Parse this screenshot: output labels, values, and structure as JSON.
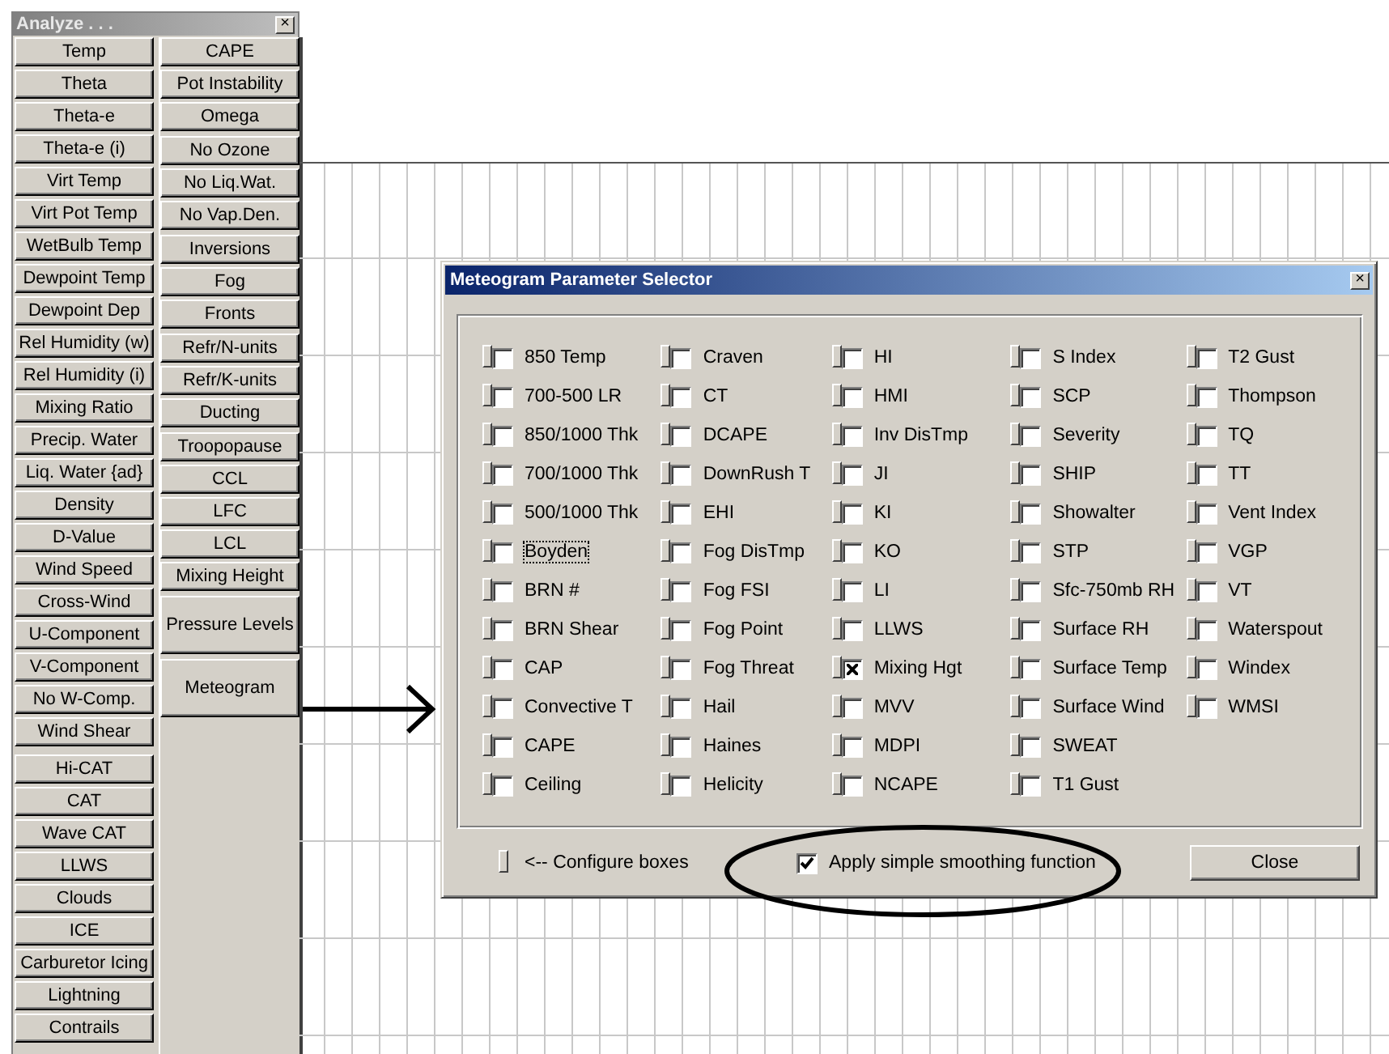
{
  "analyze_panel": {
    "title": "Analyze . . .",
    "close": "×",
    "left_groups": [
      [
        "Temp",
        "Theta",
        "Theta-e",
        "Theta-e (i)",
        "Virt Temp",
        "Virt Pot Temp",
        "WetBulb Temp",
        "Dewpoint Temp",
        "Dewpoint Dep",
        "Rel Humidity (w)",
        "Rel Humidity (i)",
        "Mixing Ratio",
        "Precip. Water",
        "Liq. Water {ad}",
        "Density",
        "D-Value",
        "Wind Speed",
        "Cross-Wind",
        "U-Component",
        "V-Component",
        "No W-Comp.",
        "Wind Shear"
      ],
      [
        "Hi-CAT",
        "CAT",
        "Wave CAT",
        "LLWS",
        "Clouds",
        "ICE",
        "Carburetor Icing",
        "Lightning",
        "Contrails"
      ]
    ],
    "right_groups": [
      [
        {
          "label": "CAPE",
          "kind": "normal"
        },
        {
          "label": "Pot Instability",
          "kind": "normal"
        },
        {
          "label": "Omega",
          "kind": "normal"
        }
      ],
      [
        {
          "label": "No Ozone",
          "kind": "normal"
        },
        {
          "label": "No Liq.Wat.",
          "kind": "normal"
        },
        {
          "label": "No Vap.Den.",
          "kind": "normal"
        }
      ],
      [
        {
          "label": "Inversions",
          "kind": "normal"
        },
        {
          "label": "Fog",
          "kind": "normal"
        },
        {
          "label": "Fronts",
          "kind": "normal"
        }
      ],
      [
        {
          "label": "Refr/N-units",
          "kind": "normal"
        },
        {
          "label": "Refr/K-units",
          "kind": "normal"
        },
        {
          "label": "Ducting",
          "kind": "normal"
        }
      ],
      [
        {
          "label": "Troopopause",
          "kind": "normal"
        },
        {
          "label": "CCL",
          "kind": "normal"
        },
        {
          "label": "LFC",
          "kind": "normal"
        },
        {
          "label": "LCL",
          "kind": "normal"
        },
        {
          "label": "Mixing Height",
          "kind": "normal"
        }
      ],
      [
        {
          "label": "Pressure Levels",
          "kind": "tall"
        }
      ],
      [
        {
          "label": "Meteogram",
          "kind": "tall"
        }
      ]
    ]
  },
  "dialog": {
    "title": "Meteogram Parameter Selector",
    "close": "×",
    "columns": [
      [
        {
          "label": "850 Temp",
          "checked": false,
          "focused": false
        },
        {
          "label": "700-500 LR",
          "checked": false,
          "focused": false
        },
        {
          "label": "850/1000 Thk",
          "checked": false,
          "focused": false
        },
        {
          "label": "700/1000 Thk",
          "checked": false,
          "focused": false
        },
        {
          "label": "500/1000 Thk",
          "checked": false,
          "focused": false
        },
        {
          "label": "Boyden",
          "checked": false,
          "focused": true
        },
        {
          "label": "BRN #",
          "checked": false,
          "focused": false
        },
        {
          "label": "BRN Shear",
          "checked": false,
          "focused": false
        },
        {
          "label": "CAP",
          "checked": false,
          "focused": false
        },
        {
          "label": "Convective T",
          "checked": false,
          "focused": false
        },
        {
          "label": "CAPE",
          "checked": false,
          "focused": false
        },
        {
          "label": "Ceiling",
          "checked": false,
          "focused": false
        }
      ],
      [
        {
          "label": "Craven",
          "checked": false,
          "focused": false
        },
        {
          "label": "CT",
          "checked": false,
          "focused": false
        },
        {
          "label": "DCAPE",
          "checked": false,
          "focused": false
        },
        {
          "label": "DownRush T",
          "checked": false,
          "focused": false
        },
        {
          "label": "EHI",
          "checked": false,
          "focused": false
        },
        {
          "label": "Fog DisTmp",
          "checked": false,
          "focused": false
        },
        {
          "label": "Fog FSI",
          "checked": false,
          "focused": false
        },
        {
          "label": "Fog Point",
          "checked": false,
          "focused": false
        },
        {
          "label": "Fog Threat",
          "checked": false,
          "focused": false
        },
        {
          "label": "Hail",
          "checked": false,
          "focused": false
        },
        {
          "label": "Haines",
          "checked": false,
          "focused": false
        },
        {
          "label": "Helicity",
          "checked": false,
          "focused": false
        }
      ],
      [
        {
          "label": "HI",
          "checked": false,
          "focused": false
        },
        {
          "label": "HMI",
          "checked": false,
          "focused": false
        },
        {
          "label": "Inv DisTmp",
          "checked": false,
          "focused": false
        },
        {
          "label": "JI",
          "checked": false,
          "focused": false
        },
        {
          "label": "KI",
          "checked": false,
          "focused": false
        },
        {
          "label": "KO",
          "checked": false,
          "focused": false
        },
        {
          "label": "LI",
          "checked": false,
          "focused": false
        },
        {
          "label": "LLWS",
          "checked": false,
          "focused": false
        },
        {
          "label": "Mixing Hgt",
          "checked": true,
          "focused": false
        },
        {
          "label": "MVV",
          "checked": false,
          "focused": false
        },
        {
          "label": "MDPI",
          "checked": false,
          "focused": false
        },
        {
          "label": "NCAPE",
          "checked": false,
          "focused": false
        }
      ],
      [
        {
          "label": "S Index",
          "checked": false,
          "focused": false
        },
        {
          "label": "SCP",
          "checked": false,
          "focused": false
        },
        {
          "label": "Severity",
          "checked": false,
          "focused": false
        },
        {
          "label": "SHIP",
          "checked": false,
          "focused": false
        },
        {
          "label": "Showalter",
          "checked": false,
          "focused": false
        },
        {
          "label": "STP",
          "checked": false,
          "focused": false
        },
        {
          "label": "Sfc-750mb RH",
          "checked": false,
          "focused": false
        },
        {
          "label": "Surface RH",
          "checked": false,
          "focused": false
        },
        {
          "label": "Surface Temp",
          "checked": false,
          "focused": false
        },
        {
          "label": "Surface Wind",
          "checked": false,
          "focused": false
        },
        {
          "label": "SWEAT",
          "checked": false,
          "focused": false
        },
        {
          "label": "T1 Gust",
          "checked": false,
          "focused": false
        }
      ],
      [
        {
          "label": "T2 Gust",
          "checked": false,
          "focused": false
        },
        {
          "label": "Thompson",
          "checked": false,
          "focused": false
        },
        {
          "label": "TQ",
          "checked": false,
          "focused": false
        },
        {
          "label": "TT",
          "checked": false,
          "focused": false
        },
        {
          "label": "Vent Index",
          "checked": false,
          "focused": false
        },
        {
          "label": "VGP",
          "checked": false,
          "focused": false
        },
        {
          "label": "VT",
          "checked": false,
          "focused": false
        },
        {
          "label": "Waterspout",
          "checked": false,
          "focused": false
        },
        {
          "label": "Windex",
          "checked": false,
          "focused": false
        },
        {
          "label": "WMSI",
          "checked": false,
          "focused": false
        }
      ]
    ],
    "configure_label": "<-- Configure boxes",
    "smoothing": {
      "label": "Apply simple smoothing function",
      "checked": true
    },
    "close_button": "Close"
  }
}
